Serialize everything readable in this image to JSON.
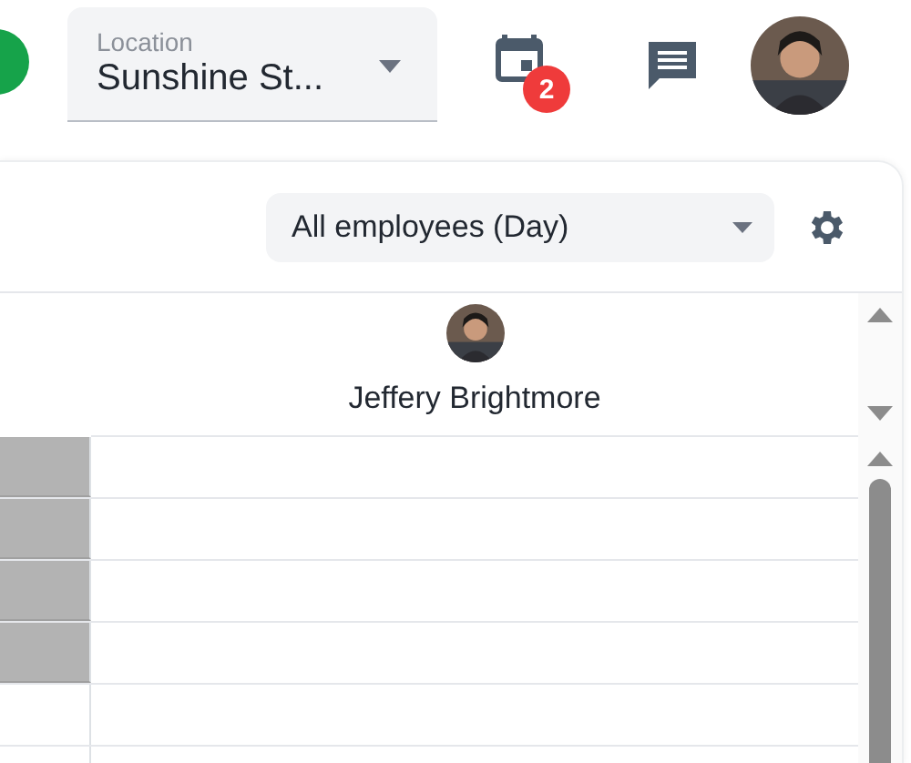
{
  "location": {
    "label": "Location",
    "value": "Sunshine St..."
  },
  "notifications": {
    "badge": "2"
  },
  "filter": {
    "value": "All employees (Day)"
  },
  "employee": {
    "name": "Jeffery Brightmore"
  },
  "rows": [
    {
      "blocked": true
    },
    {
      "blocked": true
    },
    {
      "blocked": true
    },
    {
      "blocked": true
    },
    {
      "blocked": false
    },
    {
      "blocked": false
    }
  ]
}
